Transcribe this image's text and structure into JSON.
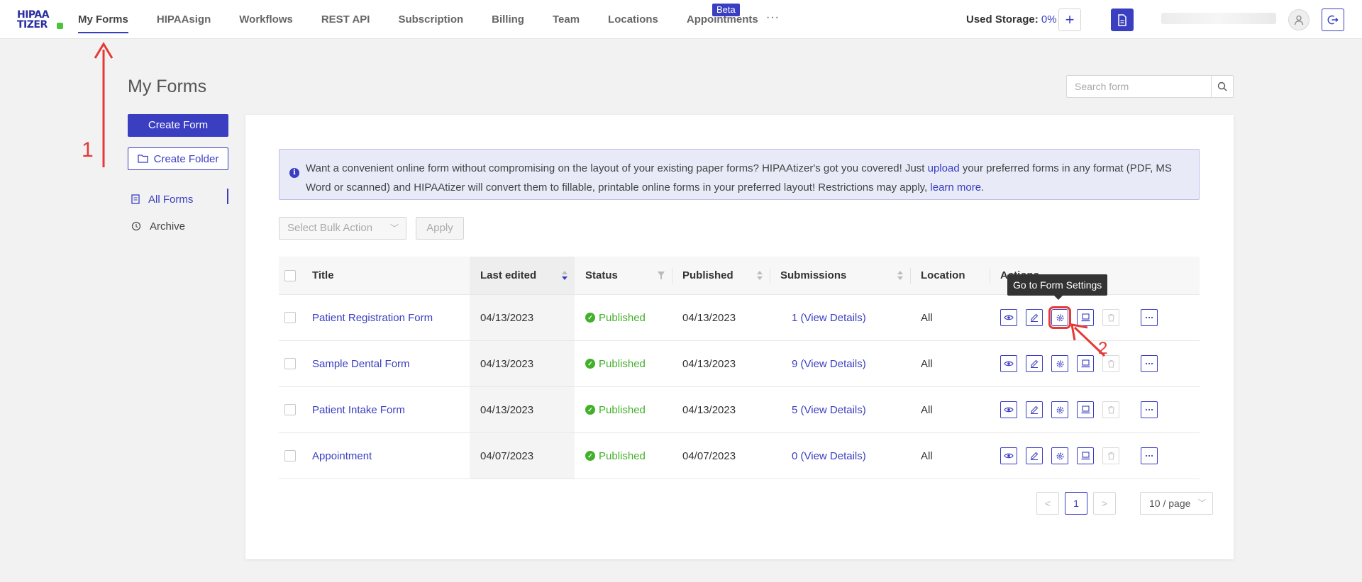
{
  "header": {
    "logo_line1": "HIPAA",
    "logo_line2": "TIZER",
    "nav": [
      {
        "label": "My Forms",
        "active": true
      },
      {
        "label": "HIPAAsign"
      },
      {
        "label": "Workflows"
      },
      {
        "label": "REST API"
      },
      {
        "label": "Subscription"
      },
      {
        "label": "Billing"
      },
      {
        "label": "Team"
      },
      {
        "label": "Locations"
      },
      {
        "label": "Appointments"
      }
    ],
    "beta_badge": "Beta",
    "more_nav": "···",
    "storage_label": "Used Storage:",
    "storage_value": "0%",
    "add_label": "+"
  },
  "sidebar": {
    "page_title": "My Forms",
    "create_form": "Create Form",
    "create_folder": "Create Folder",
    "items": [
      {
        "label": "All Forms",
        "active": true
      },
      {
        "label": "Archive"
      }
    ]
  },
  "search": {
    "placeholder": "Search form"
  },
  "info_banner": {
    "text1": "Want a convenient online form without compromising on the layout of your existing paper forms? HIPAAtizer's got you covered! Just ",
    "link1": "upload",
    "text2": " your preferred forms in any format (PDF, MS Word or scanned) and HIPAAtizer will convert them to fillable, printable online forms in your preferred layout! Restrictions may apply, ",
    "link2": "learn more",
    "text3": "."
  },
  "bulk": {
    "select_label": "Select Bulk Action",
    "apply_label": "Apply"
  },
  "table": {
    "columns": {
      "title": "Title",
      "last_edited": "Last edited",
      "status": "Status",
      "published": "Published",
      "submissions": "Submissions",
      "location": "Location",
      "actions": "Actions"
    },
    "rows": [
      {
        "title": "Patient Registration Form",
        "last_edited": "04/13/2023",
        "status": "Published",
        "published": "04/13/2023",
        "submissions": "1 (View Details)",
        "location": "All"
      },
      {
        "title": "Sample Dental Form",
        "last_edited": "04/13/2023",
        "status": "Published",
        "published": "04/13/2023",
        "submissions": "9 (View Details)",
        "location": "All"
      },
      {
        "title": "Patient Intake Form",
        "last_edited": "04/13/2023",
        "status": "Published",
        "published": "04/13/2023",
        "submissions": "5 (View Details)",
        "location": "All"
      },
      {
        "title": "Appointment",
        "last_edited": "04/07/2023",
        "status": "Published",
        "published": "04/07/2023",
        "submissions": "0 (View Details)",
        "location": "All"
      }
    ]
  },
  "tooltip": "Go to Form Settings",
  "pagination": {
    "prev": "<",
    "current": "1",
    "next": ">",
    "page_size": "10 / page"
  },
  "annotations": {
    "step1": "1",
    "step2": "2"
  },
  "colors": {
    "primary": "#3a3ec1",
    "success": "#43b02a",
    "annotation": "#e53935",
    "background": "#f2f2f2"
  }
}
